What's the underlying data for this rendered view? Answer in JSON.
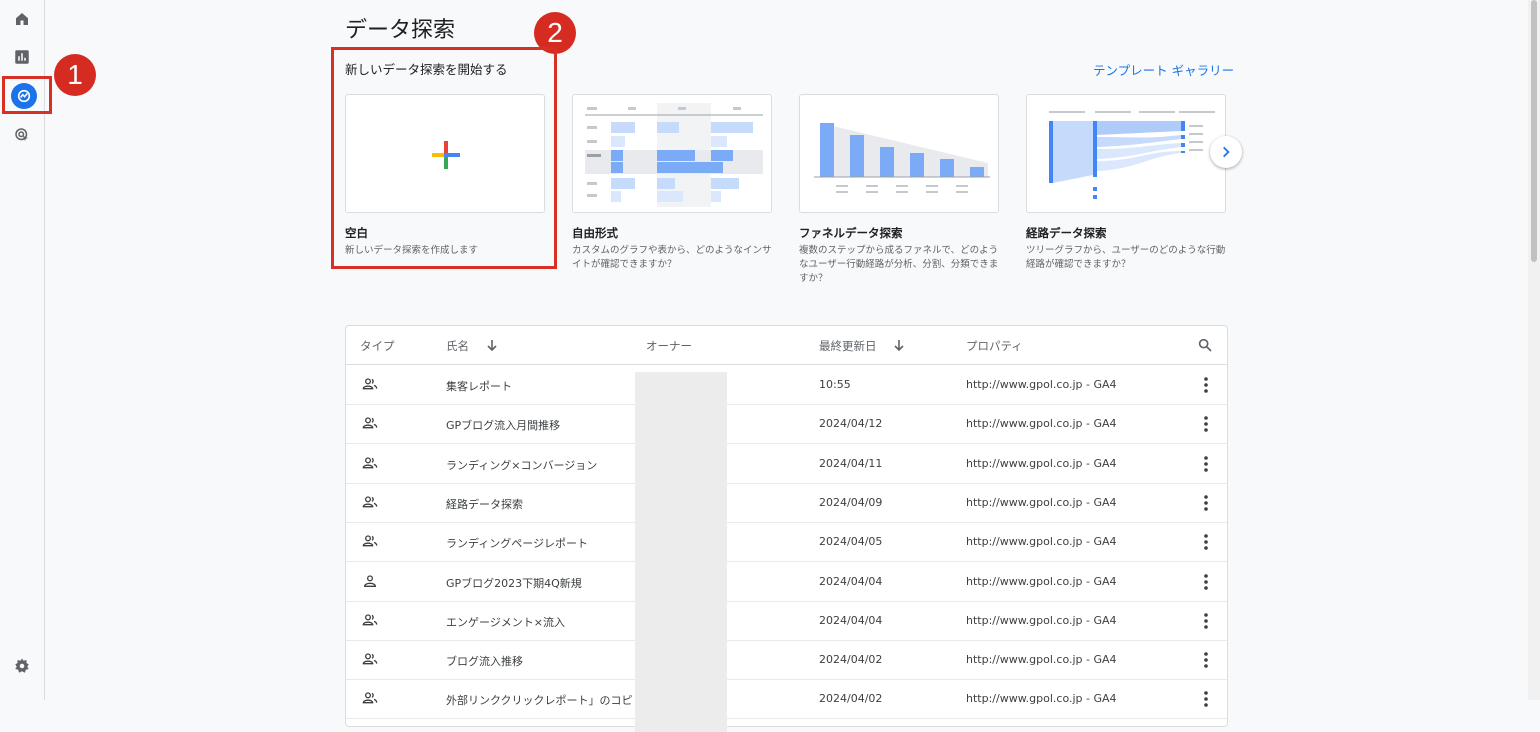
{
  "page": {
    "title": "データ探索",
    "start_label": "新しいデータ探索を開始する",
    "gallery_link": "テンプレート ギャラリー"
  },
  "callouts": [
    "1",
    "2"
  ],
  "nav": {
    "items": [
      "home-icon",
      "reports-icon",
      "explore-icon",
      "advertising-icon"
    ],
    "active": "explore-icon",
    "bottom": "settings-icon"
  },
  "templates": [
    {
      "title": "空白",
      "desc": "新しいデータ探索を作成します",
      "icon": "plus-icon"
    },
    {
      "title": "自由形式",
      "desc": "カスタムのグラフや表から、どのようなインサイトが確認できますか？",
      "icon": "table-thumbnail"
    },
    {
      "title": "ファネルデータ探索",
      "desc": "複数のステップから成るファネルで、どのようなユーザー行動経路が分析、分割、分類できますか？",
      "icon": "funnel-thumbnail"
    },
    {
      "title": "経路データ探索",
      "desc": "ツリーグラフから、ユーザーのどのような行動経路が確認できますか？",
      "icon": "path-thumbnail"
    }
  ],
  "table": {
    "headers": {
      "type": "タイプ",
      "name": "氏名",
      "owner": "オーナー",
      "updated": "最終更新日",
      "property": "プロパティ"
    },
    "rows": [
      {
        "type": "shared",
        "name": "集客レポート",
        "date": "10:55",
        "property": "http://www.gpol.co.jp - GA4"
      },
      {
        "type": "shared",
        "name": "GPブログ流入月間推移",
        "date": "2024/04/12",
        "property": "http://www.gpol.co.jp - GA4"
      },
      {
        "type": "shared",
        "name": "ランディング×コンバージョン",
        "date": "2024/04/11",
        "property": "http://www.gpol.co.jp - GA4"
      },
      {
        "type": "shared",
        "name": "経路データ探索",
        "date": "2024/04/09",
        "property": "http://www.gpol.co.jp - GA4"
      },
      {
        "type": "shared",
        "name": "ランディングページレポート",
        "date": "2024/04/05",
        "property": "http://www.gpol.co.jp - GA4"
      },
      {
        "type": "single",
        "name": "GPブログ2023下期4Q新規",
        "date": "2024/04/04",
        "property": "http://www.gpol.co.jp - GA4"
      },
      {
        "type": "shared",
        "name": "エンゲージメント×流入",
        "date": "2024/04/04",
        "property": "http://www.gpol.co.jp - GA4"
      },
      {
        "type": "shared",
        "name": "ブログ流入推移",
        "date": "2024/04/02",
        "property": "http://www.gpol.co.jp - GA4"
      },
      {
        "type": "shared",
        "name": "外部リンククリックレポート」のコピ",
        "date": "2024/04/02",
        "property": "http://www.gpol.co.jp - GA4"
      }
    ]
  },
  "colors": {
    "accent": "#1a73e8",
    "highlight": "#d93025"
  }
}
